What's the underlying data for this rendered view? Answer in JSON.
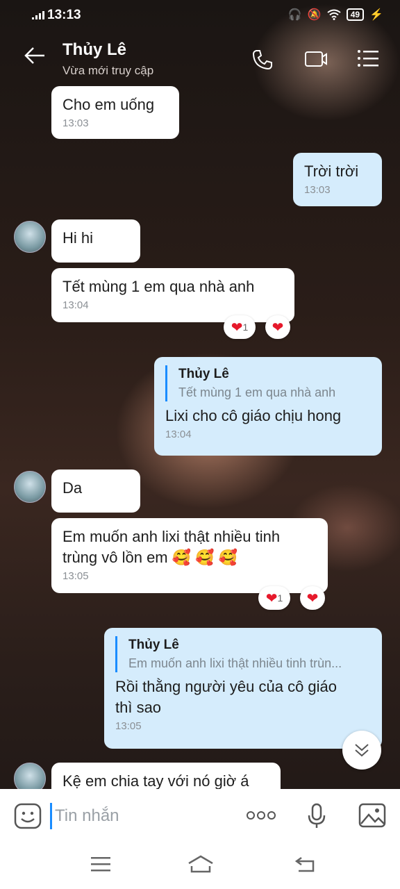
{
  "status_bar": {
    "time": "13:13",
    "battery": "49"
  },
  "header": {
    "contact_name": "Thủy Lê",
    "status": "Vừa mới truy cập"
  },
  "messages": [
    {
      "text": "Cho em uống",
      "time": "13:03"
    },
    {
      "text": "Trời trời",
      "time": "13:03"
    },
    {
      "text": "Hi hi"
    },
    {
      "text": "Tết mùng 1 em qua nhà anh",
      "time": "13:04",
      "reaction_count": "1"
    },
    {
      "quote_name": "Thủy Lê",
      "quote_text": "Tết mùng 1 em qua nhà anh",
      "text": "Lixi cho cô giáo chịu hong",
      "time": "13:04"
    },
    {
      "text": "Da"
    },
    {
      "text_line1": "Em muốn anh lixi thật nhiều tinh",
      "text_line2": "trùng vô lồn em",
      "time": "13:05",
      "reaction_count": "1"
    },
    {
      "quote_name": "Thủy Lê",
      "quote_text": "Em muốn anh lixi thật nhiều tinh trùn...",
      "text_line1": "Rồi thằng người yêu của cô giáo",
      "text_line2": "thì sao",
      "time": "13:05"
    },
    {
      "text": "Kệ em chia tay với nó giờ á"
    }
  ],
  "input": {
    "placeholder": "Tin nhắn"
  },
  "colors": {
    "accent": "#1a8cff",
    "outgoing_bubble": "#d5ecfc",
    "incoming_bubble": "#ffffff",
    "heart": "#e6192b"
  }
}
